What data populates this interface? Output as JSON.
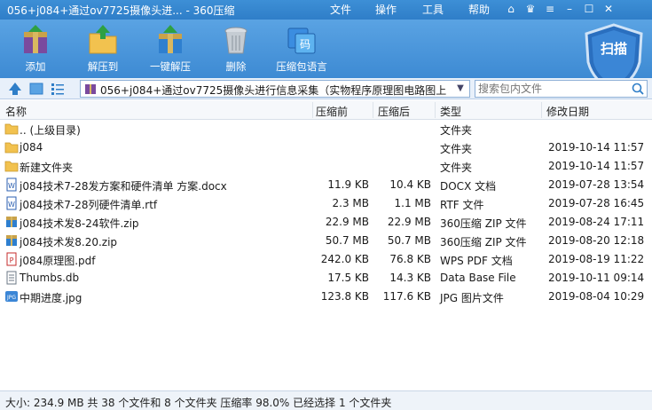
{
  "window": {
    "title": "056+j084+通过ov7725摄像头进... - 360压缩",
    "menu": [
      "文件",
      "操作",
      "工具",
      "帮助"
    ]
  },
  "toolbar": {
    "buttons": [
      {
        "label": "添加",
        "icon": "add-archive-icon"
      },
      {
        "label": "解压到",
        "icon": "extract-to-icon"
      },
      {
        "label": "一键解压",
        "icon": "one-click-extract-icon"
      },
      {
        "label": "删除",
        "icon": "trash-icon"
      },
      {
        "label": "压缩包语言",
        "icon": "archive-language-icon"
      }
    ],
    "scan_label": "扫描"
  },
  "address": {
    "path": "056+j084+通过ov7725摄像头进行信息采集（实物程序原理图电路图上",
    "search_placeholder": "搜索包内文件"
  },
  "columns": [
    "名称",
    "压缩前",
    "压缩后",
    "类型",
    "修改日期"
  ],
  "files": [
    {
      "name": ".. (上级目录)",
      "before": "",
      "after": "",
      "type": "文件夹",
      "date": "",
      "icon": "folder-icon"
    },
    {
      "name": "j084",
      "before": "",
      "after": "",
      "type": "文件夹",
      "date": "2019-10-14 11:57",
      "icon": "folder-icon"
    },
    {
      "name": "新建文件夹",
      "before": "",
      "after": "",
      "type": "文件夹",
      "date": "2019-10-14 11:57",
      "icon": "folder-icon"
    },
    {
      "name": "j084技术7-28发方案和硬件清单 方案.docx",
      "before": "11.9 KB",
      "after": "10.4 KB",
      "type": "DOCX 文档",
      "date": "2019-07-28 13:54",
      "icon": "docx-file-icon"
    },
    {
      "name": "j084技术7-28列硬件清单.rtf",
      "before": "2.3 MB",
      "after": "1.1 MB",
      "type": "RTF 文件",
      "date": "2019-07-28 16:45",
      "icon": "rtf-file-icon"
    },
    {
      "name": "j084技术发8-24软件.zip",
      "before": "22.9 MB",
      "after": "22.9 MB",
      "type": "360压缩 ZIP 文件",
      "date": "2019-08-24 17:11",
      "icon": "zip-file-icon"
    },
    {
      "name": "j084技术发8.20.zip",
      "before": "50.7 MB",
      "after": "50.7 MB",
      "type": "360压缩 ZIP 文件",
      "date": "2019-08-20 12:18",
      "icon": "zip-file-icon"
    },
    {
      "name": "j084原理图.pdf",
      "before": "242.0 KB",
      "after": "76.8 KB",
      "type": "WPS PDF 文档",
      "date": "2019-08-19 11:22",
      "icon": "pdf-file-icon"
    },
    {
      "name": "Thumbs.db",
      "before": "17.5 KB",
      "after": "14.3 KB",
      "type": "Data Base File",
      "date": "2019-10-11 09:14",
      "icon": "db-file-icon"
    },
    {
      "name": "中期进度.jpg",
      "before": "123.8 KB",
      "after": "117.6 KB",
      "type": "JPG 图片文件",
      "date": "2019-08-04 10:29",
      "icon": "jpg-file-icon"
    }
  ],
  "status": "大小: 234.9 MB 共 38 个文件和 8 个文件夹 压缩率 98.0% 已经选择 1 个文件夹",
  "colors": {
    "titlebar": "#2f7ec8",
    "toolbar": "#4a97db",
    "folder": "#f2c24f"
  }
}
